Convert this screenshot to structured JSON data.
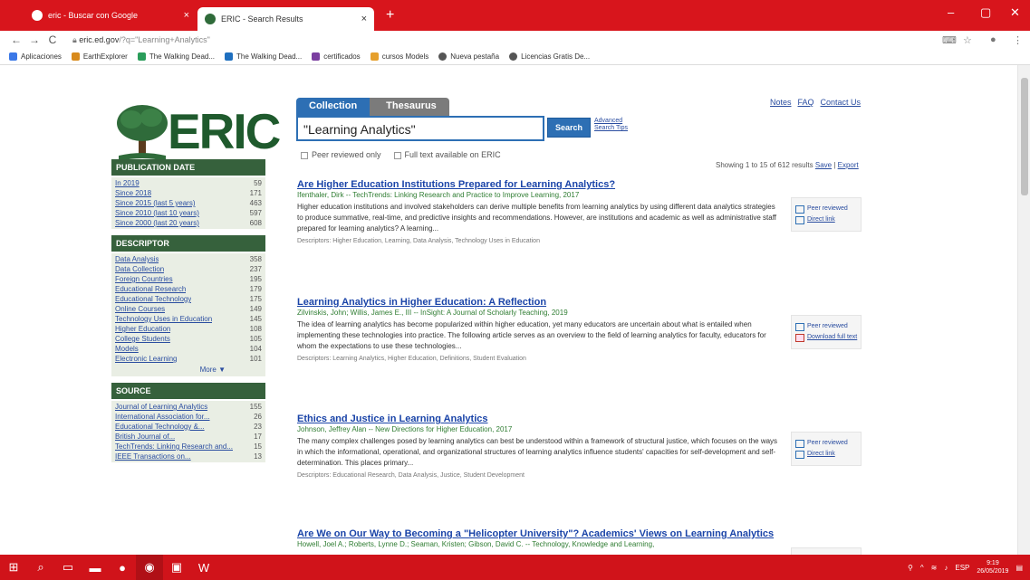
{
  "browser": {
    "tabs": [
      {
        "title": "eric - Buscar con Google",
        "close": "×"
      },
      {
        "title": "ERIC - Search Results",
        "close": "×"
      }
    ],
    "new_tab": "+",
    "window_controls": {
      "minimize": "–",
      "maximize": "▢",
      "close": "✕"
    },
    "nav": {
      "back": "←",
      "forward": "→",
      "reload": "C"
    },
    "url_host": "eric.ed.gov",
    "url_rest": "/?q=\"Learning+Analytics\"",
    "bookmarks": [
      {
        "label": "Aplicaciones",
        "color": "#3b78e7"
      },
      {
        "label": "EarthExplorer",
        "color": "#d88a1c"
      },
      {
        "label": "The Walking Dead...",
        "color": "#2a9d5a"
      },
      {
        "label": "The Walking Dead...",
        "color": "#1f6fbf"
      },
      {
        "label": "certificados",
        "color": "#7b3fa0"
      },
      {
        "label": "cursos Models",
        "color": "#e6a02c"
      },
      {
        "label": "Nueva pestaña",
        "color": "#555555"
      },
      {
        "label": "Licencias Gratis De...",
        "color": "#555555"
      }
    ]
  },
  "header": {
    "logo_text": "ERIC",
    "links": [
      "Notes",
      "FAQ",
      "Contact Us"
    ]
  },
  "search": {
    "tabs": {
      "collection": "Collection",
      "thesaurus": "Thesaurus"
    },
    "query": "\"Learning Analytics\"",
    "button": "Search",
    "advanced_line1": "Advanced",
    "advanced_line2": "Search Tips",
    "filters": {
      "peer": "Peer reviewed only",
      "fulltext": "Full text available on ERIC"
    }
  },
  "results_info": {
    "showing": "Showing 1 to 15 of 612 results",
    "save": "Save",
    "sep": "|",
    "export": "Export"
  },
  "facets": {
    "publication_date": {
      "title": "PUBLICATION DATE",
      "items": [
        {
          "label": "In 2019",
          "count": "59"
        },
        {
          "label": "Since 2018",
          "count": "171"
        },
        {
          "label": "Since 2015 (last 5 years)",
          "count": "463"
        },
        {
          "label": "Since 2010 (last 10 years)",
          "count": "597"
        },
        {
          "label": "Since 2000 (last 20 years)",
          "count": "608"
        }
      ]
    },
    "descriptor": {
      "title": "DESCRIPTOR",
      "items": [
        {
          "label": "Data Analysis",
          "count": "358"
        },
        {
          "label": "Data Collection",
          "count": "237"
        },
        {
          "label": "Foreign Countries",
          "count": "195"
        },
        {
          "label": "Educational Research",
          "count": "179"
        },
        {
          "label": "Educational Technology",
          "count": "175"
        },
        {
          "label": "Online Courses",
          "count": "149"
        },
        {
          "label": "Technology Uses in Education",
          "count": "145"
        },
        {
          "label": "Higher Education",
          "count": "108"
        },
        {
          "label": "College Students",
          "count": "105"
        },
        {
          "label": "Models",
          "count": "104"
        },
        {
          "label": "Electronic Learning",
          "count": "101"
        }
      ],
      "more": "More ▼"
    },
    "source": {
      "title": "SOURCE",
      "items": [
        {
          "label": "Journal of Learning Analytics",
          "count": "155"
        },
        {
          "label": "International Association for...",
          "count": "26"
        },
        {
          "label": "Educational Technology &...",
          "count": "23"
        },
        {
          "label": "British Journal of...",
          "count": "17"
        },
        {
          "label": "TechTrends: Linking Research and...",
          "count": "15"
        },
        {
          "label": "IEEE Transactions on...",
          "count": "13"
        }
      ]
    }
  },
  "results": [
    {
      "title": "Are Higher Education Institutions Prepared for Learning Analytics?",
      "author": "Ifenthaler, Dirk -- TechTrends: Linking Research and Practice to Improve Learning, 2017",
      "description": "Higher education institutions and involved stakeholders can derive multiple benefits from learning analytics by using different data analytics strategies to produce summative, real-time, and predictive insights and recommendations. However, are institutions and academic as well as administrative staff prepared for learning analytics? A learning...",
      "descriptors": "Descriptors: Higher Education, Learning, Data Analysis, Technology Uses in Education",
      "side": [
        {
          "icon": "peer-reviewed-icon",
          "label": "Peer reviewed",
          "link": false
        },
        {
          "icon": "direct-link-icon",
          "label": "Direct link",
          "link": true
        }
      ]
    },
    {
      "title": "Learning Analytics in Higher Education: A Reflection",
      "author": "Zilvinskis, John; Willis, James E., III -- InSight: A Journal of Scholarly Teaching, 2019",
      "description": "The idea of learning analytics has become popularized within higher education, yet many educators are uncertain about what is entailed when implementing these technologies into practice. The following article serves as an overview to the field of learning analytics for faculty, educators for whom the expectations to use these technologies...",
      "descriptors": "Descriptors: Learning Analytics, Higher Education, Definitions, Student Evaluation",
      "side": [
        {
          "icon": "peer-reviewed-icon",
          "label": "Peer reviewed",
          "link": false
        },
        {
          "icon": "pdf-icon",
          "label": "Download full text",
          "link": true
        }
      ]
    },
    {
      "title": "Ethics and Justice in Learning Analytics",
      "author": "Johnson, Jeffrey Alan -- New Directions for Higher Education, 2017",
      "description": "The many complex challenges posed by learning analytics can best be understood within a framework of structural justice, which focuses on the ways in which the informational, operational, and organizational structures of learning analytics influence students' capacities for self-development and self-determination. This places primary...",
      "descriptors": "Descriptors: Educational Research, Data Analysis, Justice, Student Development",
      "side": [
        {
          "icon": "peer-reviewed-icon",
          "label": "Peer reviewed",
          "link": false
        },
        {
          "icon": "direct-link-icon",
          "label": "Direct link",
          "link": true
        }
      ]
    },
    {
      "title": "Are We on Our Way to Becoming a \"Helicopter University\"? Academics' Views on Learning Analytics",
      "author": "Howell, Joel A.; Roberts, Lynne D.; Seaman, Kristen; Gibson, David C. -- Technology, Knowledge and Learning,",
      "description": "",
      "descriptors": "",
      "side": []
    }
  ],
  "taskbar": {
    "start": "⊞",
    "search": "⌕",
    "clock_time": "9:19",
    "clock_date": "26/05/2019",
    "lang": "ESP"
  }
}
